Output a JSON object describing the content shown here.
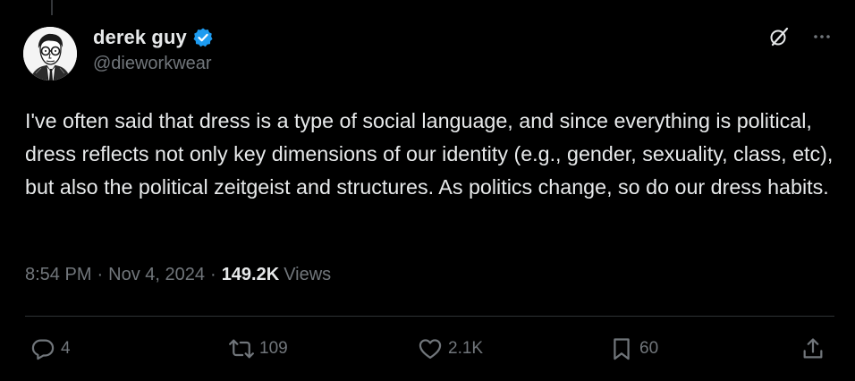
{
  "tweet": {
    "author": {
      "display_name": "derek guy",
      "handle": "@dieworkwear",
      "verified": true
    },
    "text": "I've often said that dress is a type of social language, and since everything is political, dress reflects not only key dimensions of our identity (e.g., gender, sexuality, class, etc), but also the political zeitgeist and structures. As politics change, so do our dress habits.",
    "meta": {
      "time": "8:54 PM",
      "date": "Nov 4, 2024",
      "separator": "·",
      "views_count": "149.2K",
      "views_label": "Views"
    },
    "actions": {
      "replies": "4",
      "reposts": "109",
      "likes": "2.1K",
      "bookmarks": "60"
    }
  },
  "colors": {
    "background": "#000000",
    "text_primary": "#e7e9ea",
    "text_secondary": "#71767b",
    "verified_blue": "#1d9bf0",
    "divider": "#2f3336"
  },
  "icons": {
    "verified": "verified-badge-icon",
    "grok": "grok-icon",
    "more": "more-icon",
    "reply": "reply-icon",
    "repost": "repost-icon",
    "like": "heart-icon",
    "bookmark": "bookmark-icon",
    "share": "share-icon"
  }
}
